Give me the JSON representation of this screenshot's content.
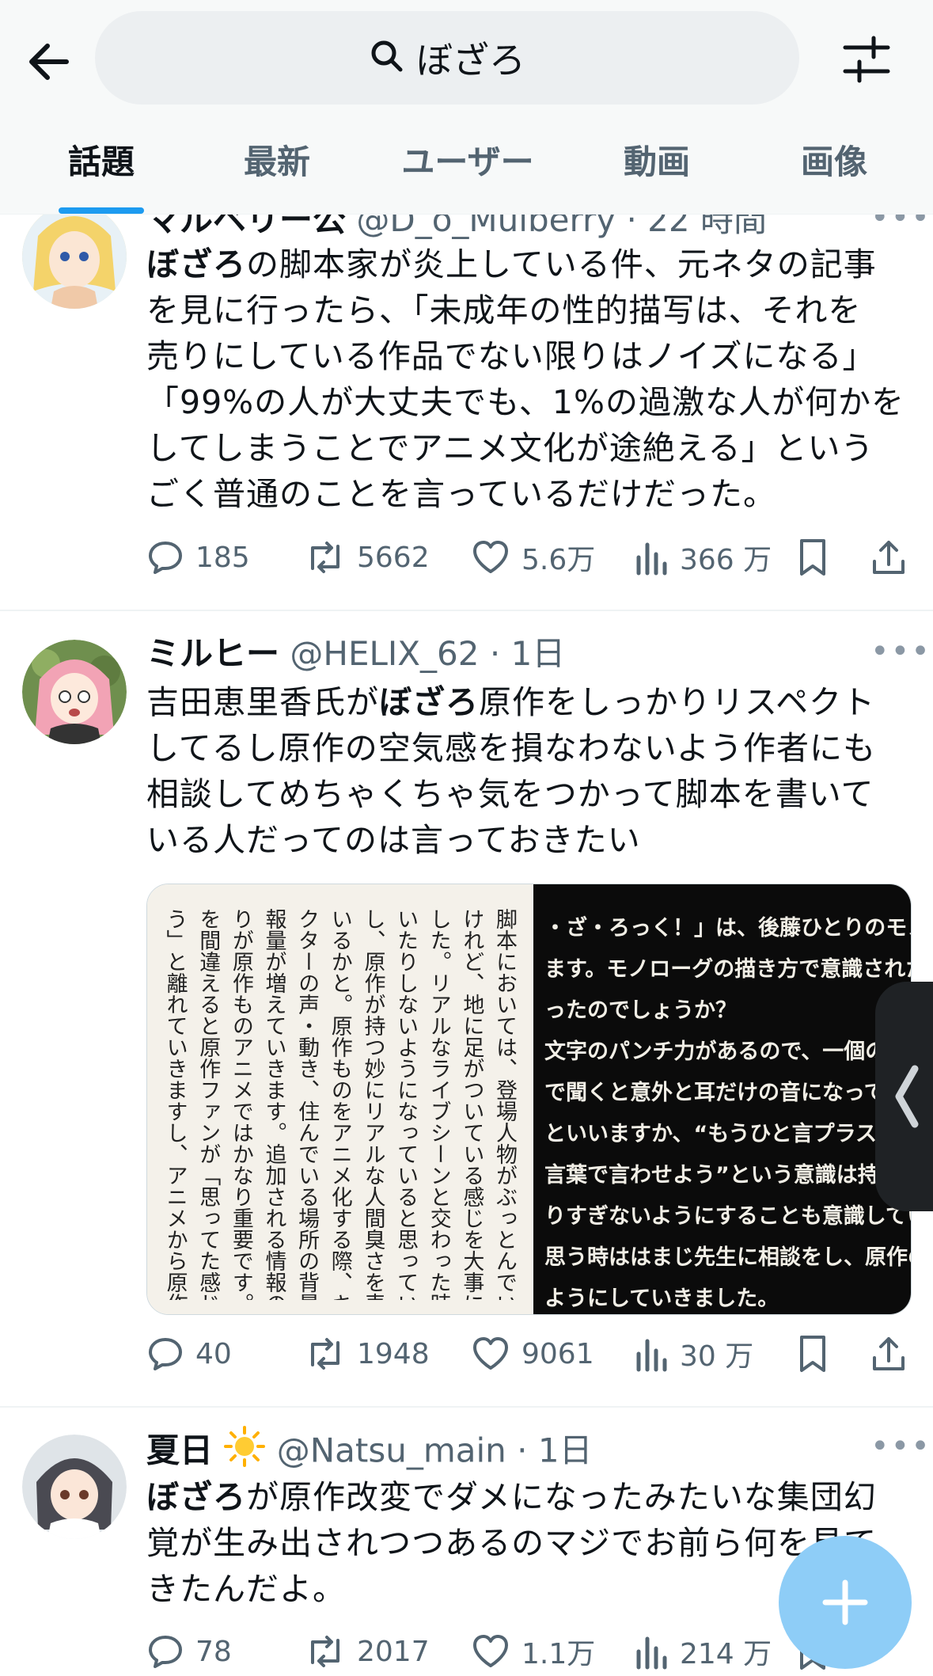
{
  "search": {
    "query": "ぼざろ"
  },
  "tabs": [
    "話題",
    "最新",
    "ユーザー",
    "動画",
    "画像"
  ],
  "tweets": [
    {
      "name": "マルベリー公",
      "handle": "@D_o_Mulberry",
      "time": "22 時間",
      "body_lines": [
        {
          "bold": "ぼざろ",
          "text": "の脚本家が炎上している件、元ネタの記事"
        },
        {
          "bold": "",
          "text": "を見に行ったら、「未成年の性的描写は、それを"
        },
        {
          "bold": "",
          "text": "売りにしている作品でない限りはノイズになる」"
        },
        {
          "bold": "",
          "text": "「99%の人が大丈夫でも、1%の過激な人が何かを"
        },
        {
          "bold": "",
          "text": "してしまうことでアニメ文化が途絶える」という"
        },
        {
          "bold": "",
          "text": "ごく普通のことを言っているだけだった。"
        }
      ],
      "replies": "185",
      "retweets": "5662",
      "likes": "5.6万",
      "views": "366 万"
    },
    {
      "name": "ミルヒー",
      "handle": "@HELIX_62",
      "time": "1日",
      "body_lines": [
        {
          "pre": "吉田恵里香氏が",
          "bold": "ぼざろ",
          "text": "原作をしっかりリスペクト"
        },
        {
          "pre": "",
          "bold": "",
          "text": "してるし原作の空気感を損なわないよう作者にも"
        },
        {
          "pre": "",
          "bold": "",
          "text": "相談してめちゃくちゃ気をつかって脚本を書いて"
        },
        {
          "pre": "",
          "bold": "",
          "text": "いる人だってのは言っておきたい"
        }
      ],
      "image": {
        "left_columns": [
          "脚本においては、登場人物がぶっとんでいる",
          "けれど、地に足がついている感じを大事にしま",
          "した。リアルなライブシーンと交わった時に浮",
          "いたりしないようになっていると思っています",
          "し、原作が持つ妙にリアルな人間臭さを表せて",
          "いるかと。原作ものをアニメ化する際、キャラ",
          "クターの声・動き、住んでいる場所の背景など情",
          "報量が増えていきます。追加される情報の舵取",
          "りが原作ものアニメではかなり重要です。ここ",
          "を間違えると原作ファンが「思ってた感じと違",
          "う」と離れていきますし、アニメから原作を読ん"
        ],
        "right_lines": [
          "・ざ・ろっく！」は、後藤ひとりのモノロー",
          "ます。モノローグの描き方で意識されたの",
          "ったのでしょうか？",
          "文字のパンチ力があるので、一個の単語だ",
          "で聞くと意外と耳だけの音になってしま",
          "といいますか、“もうひと言プラスで言わ",
          "言葉で言わせよう”という意識は持っ",
          "りすぎないようにすることも意識していて",
          "思う時ははまじ先生に相談をし、原作のモノ",
          "ようにしていきました。"
        ]
      },
      "replies": "40",
      "retweets": "1948",
      "likes": "9061",
      "views": "30 万"
    },
    {
      "name": "夏日",
      "handle": "@Natsu_main",
      "time": "1日",
      "body_lines": [
        {
          "bold": "ぼざろ",
          "text": "が原作改変でダメになったみたいな集団幻"
        },
        {
          "bold": "",
          "text": "覚が生み出されつつあるのマジでお前ら何を見て"
        },
        {
          "bold": "",
          "text": "きたんだよ。"
        }
      ],
      "replies": "78",
      "retweets": "2017",
      "likes": "1.1万",
      "views": "214 万"
    }
  ],
  "colors": {
    "accent": "#1d9bf0",
    "muted": "#536471",
    "text": "#0f1419",
    "fab": "#8ecdf7"
  }
}
